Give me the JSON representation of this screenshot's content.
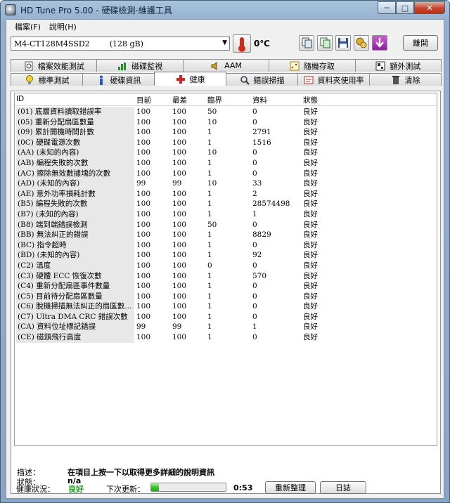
{
  "window": {
    "title": "HD Tune Pro  5.00 - 硬碟檢測-維護工具",
    "controls": {
      "minimize": "─",
      "maximize": "□",
      "close": "✕"
    }
  },
  "menu": [
    {
      "label": "檔案(F)"
    },
    {
      "label": "說明(H)"
    }
  ],
  "toolbar": {
    "drive": "M4-CT128M4SSD2",
    "capacity": "(128 gB)",
    "temperature": "0℃",
    "exit_label": "離開"
  },
  "tabs_top": [
    {
      "label": "檔案效能測試"
    },
    {
      "label": "磁碟監視"
    },
    {
      "label": "AAM"
    },
    {
      "label": "隨機存取"
    },
    {
      "label": "額外測試"
    }
  ],
  "tabs_bottom": [
    {
      "label": "標準測試"
    },
    {
      "label": "硬碟資訊"
    },
    {
      "label": "健康",
      "active": true
    },
    {
      "label": "錯誤掃描"
    },
    {
      "label": "資料夾使用率"
    },
    {
      "label": "清除"
    }
  ],
  "table": {
    "columns": {
      "id": "ID",
      "current": "目前",
      "worst": "最差",
      "threshold": "臨界",
      "data": "資料",
      "status": "狀態"
    },
    "rows": [
      [
        "(01) 底層資料讀取錯誤率",
        "100",
        "100",
        "50",
        "0",
        "良好"
      ],
      [
        "(05) 重新分配扇區數量",
        "100",
        "100",
        "10",
        "0",
        "良好"
      ],
      [
        "(09) 累計開機時間計數",
        "100",
        "100",
        "1",
        "2791",
        "良好"
      ],
      [
        "(0C) 硬碟電源次數",
        "100",
        "100",
        "1",
        "1516",
        "良好"
      ],
      [
        "(AA) (未知的內容)",
        "100",
        "100",
        "10",
        "0",
        "良好"
      ],
      [
        "(AB) 編程失敗的次數",
        "100",
        "100",
        "1",
        "0",
        "良好"
      ],
      [
        "(AC) 擦除無效數據塊的次數",
        "100",
        "100",
        "1",
        "0",
        "良好"
      ],
      [
        "(AD) (未知的內容)",
        "99",
        "99",
        "10",
        "33",
        "良好"
      ],
      [
        "(AE) 意外功率損耗計數",
        "100",
        "100",
        "1",
        "2",
        "良好"
      ],
      [
        "(B5) 編程失敗的次數",
        "100",
        "100",
        "1",
        "28574498",
        "良好"
      ],
      [
        "(B7) (未知的內容)",
        "100",
        "100",
        "1",
        "1",
        "良好"
      ],
      [
        "(B8) 端到端錯誤檢測",
        "100",
        "100",
        "50",
        "0",
        "良好"
      ],
      [
        "(BB) 無法糾正的錯誤",
        "100",
        "100",
        "1",
        "8829",
        "良好"
      ],
      [
        "(BC) 指令超時",
        "100",
        "100",
        "1",
        "0",
        "良好"
      ],
      [
        "(BD) (未知的內容)",
        "100",
        "100",
        "1",
        "92",
        "良好"
      ],
      [
        "(C2) 溫度",
        "100",
        "100",
        "0",
        "0",
        "良好"
      ],
      [
        "(C3) 硬體 ECC 恢復次數",
        "100",
        "100",
        "1",
        "570",
        "良好"
      ],
      [
        "(C4) 重新分配扇區事件數量",
        "100",
        "100",
        "1",
        "0",
        "良好"
      ],
      [
        "(C5) 目前待分配扇區數量",
        "100",
        "100",
        "1",
        "0",
        "良好"
      ],
      [
        "(C6) 脫機掃描無法糾正的扇區數...",
        "100",
        "100",
        "1",
        "0",
        "良好"
      ],
      [
        "(C7) Ultra DMA CRC 錯誤次數",
        "100",
        "100",
        "1",
        "0",
        "良好"
      ],
      [
        "(CA) 資料位址標記錯誤",
        "99",
        "99",
        "1",
        "1",
        "良好"
      ],
      [
        "(CE) 磁頭飛行高度",
        "100",
        "100",
        "1",
        "0",
        "良好"
      ]
    ]
  },
  "description": {
    "desc_label": "描述：",
    "desc_value": "在項目上按一下以取得更多詳細的說明資訊",
    "status_label": "狀態：",
    "status_value": "n/a"
  },
  "footer": {
    "health_label": "健康狀況：",
    "health_value": "良好",
    "next_update_label": "下次更新：",
    "progress_fraction": 0.1,
    "countdown": "0:53",
    "refresh_label": "重新整理",
    "log_label": "日誌"
  },
  "colors": {
    "health_good": "#1c9a1c",
    "progress": "#40c030"
  }
}
